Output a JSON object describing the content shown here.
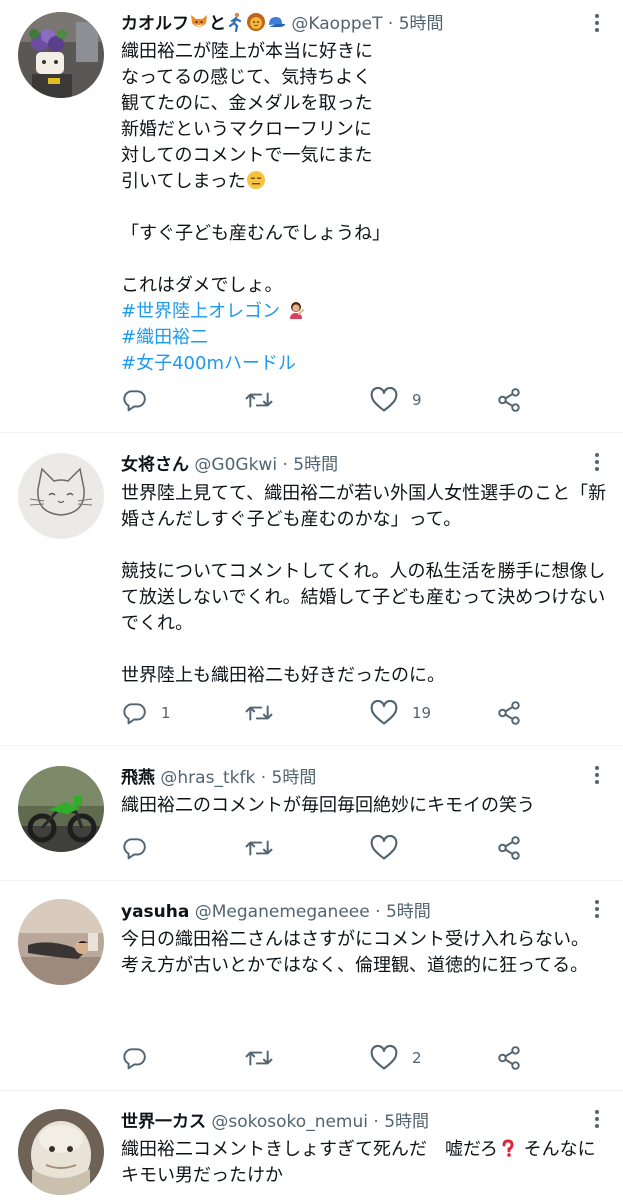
{
  "tweets": [
    {
      "name": "カオルフ",
      "name_tail": "と",
      "handle": "@KaoppeT",
      "time": "5時間",
      "lines": [
        "織田裕二が陸上が本当に好きに",
        "なってるの感じて、気持ちよく",
        "観てたのに、金メダルを取った",
        "新婚だというマクローフリンに",
        "対してのコメントで一気にまた",
        "引いてしまった"
      ],
      "quote": "「すぐ子ども産むんでしょうね」",
      "closing": "これはダメでしょ。",
      "hashtags": [
        "#世界陸上オレゴン",
        "#織田裕二",
        "#女子400mハードル"
      ],
      "replies": "",
      "retweets": "",
      "likes": "9"
    },
    {
      "name": "女将さん",
      "handle": "@G0Gkwi",
      "time": "5時間",
      "paragraphs": [
        "世界陸上見てて、織田裕二が若い外国人女性選手のこと「新婚さんだしすぐ子ども産むのかな」って。",
        "競技についてコメントしてくれ。人の私生活を勝手に想像して放送しないでくれ。結婚して子ども産むって決めつけないでくれ。",
        "世界陸上も織田裕二も好きだったのに。"
      ],
      "replies": "1",
      "retweets": "",
      "likes": "19"
    },
    {
      "name": "飛燕",
      "handle": "@hras_tkfk",
      "time": "5時間",
      "text": "織田裕二のコメントが毎回毎回絶妙にキモイの笑う",
      "replies": "",
      "retweets": "",
      "likes": ""
    },
    {
      "name": "yasuha",
      "handle": "@Meganemeganeee",
      "time": "5時間",
      "paragraphs": [
        "今日の織田裕二さんはさすがにコメント受け入れらない。",
        "考え方が古いとかではなく、倫理観、道徳的に狂ってる。"
      ],
      "replies": "",
      "retweets": "",
      "likes": "2"
    },
    {
      "name": "世界一カス",
      "handle": "@sokosoko_nemui",
      "time": "5時間",
      "text_before": "織田裕二コメントきしょすぎて死んだ　嘘だろ",
      "text_after": "そんなにキモい男だったけか"
    }
  ],
  "separator": "·",
  "icons": {
    "more": "more-dots-icon",
    "reply": "reply-icon",
    "retweet": "retweet-icon",
    "like": "heart-icon",
    "share": "share-icon"
  },
  "colors": {
    "hashtag": "#1d9bf0",
    "secondary": "#536471",
    "divider": "#eff3f4"
  }
}
